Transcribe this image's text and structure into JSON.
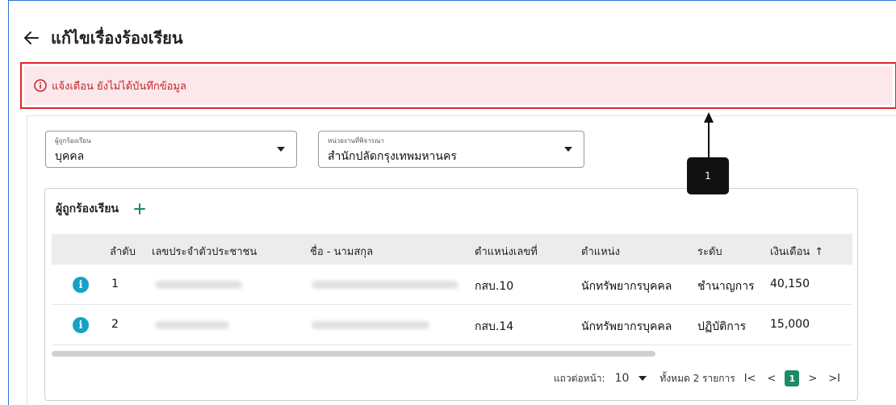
{
  "header": {
    "title": "แก้ไขเรื่องร้องเรียน"
  },
  "alert": {
    "text": "แจ้งเตือน ยังไม่ได้บันทึกข้อมูล"
  },
  "filters": {
    "complainee_type": {
      "label": "ผู้ถูกร้องเรียน",
      "value": "บุคคล"
    },
    "agency": {
      "label": "หน่วยงานที่พิจารณา",
      "value": "สำนักปลัดกรุงเทพมหานคร"
    }
  },
  "table": {
    "title": "ผู้ถูกร้องเรียน",
    "columns": [
      "ลำดับ",
      "เลขประจำตัวประชาชน",
      "ชื่อ - นามสกุล",
      "ตำแหน่งเลขที่",
      "ตำแหน่ง",
      "ระดับ",
      "เงินเดือน"
    ],
    "rows": [
      {
        "index": "1",
        "position_no": "กสบ.10",
        "position": "นักทรัพยากรบุคคล",
        "level": "ชำนาญการ",
        "salary": "40,150"
      },
      {
        "index": "2",
        "position_no": "กสบ.14",
        "position": "นักทรัพยากรบุคคล",
        "level": "ปฏิบัติการ",
        "salary": "15,000"
      }
    ]
  },
  "pagination": {
    "rows_per_page_label": "แถวต่อหน้า:",
    "rows_per_page": "10",
    "total": "ทั้งหมด 2 รายการ",
    "current_page": "1",
    "first": "I<",
    "prev": "<",
    "next": ">",
    "last": ">I"
  },
  "callout": {
    "label": "1"
  },
  "colors": {
    "alert_border": "#e3242b",
    "alert_bg": "#fce8ea",
    "accent": "#1c8a66",
    "info": "#17a2c4"
  }
}
